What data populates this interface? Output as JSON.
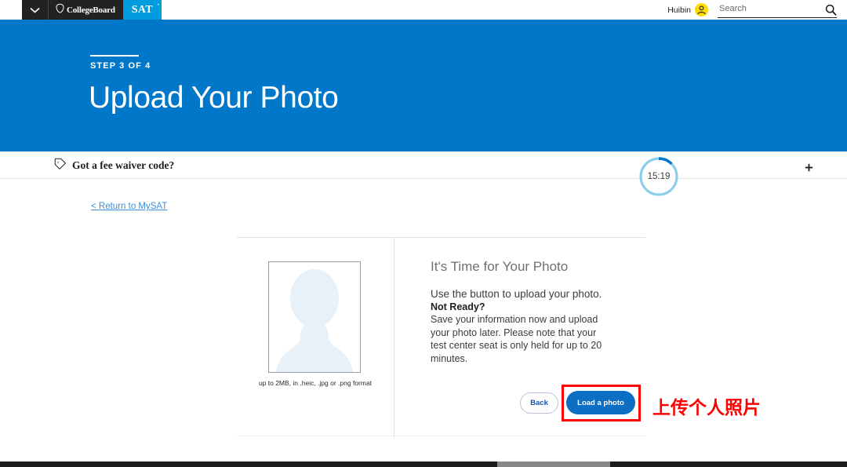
{
  "topnav": {
    "caret_icon": "chevron-down-icon",
    "brand": "CollegeBoard",
    "product": "SAT",
    "trademark": "™",
    "user_name": "Huibin",
    "avatar_icon": "user-avatar-icon",
    "search": {
      "placeholder": "Search",
      "value": "",
      "icon": "search-icon"
    }
  },
  "hero": {
    "step": "STEP 3 OF 4",
    "title": "Upload Your Photo",
    "background_color": "#0077C8"
  },
  "fee_bar": {
    "icon": "price-tag-icon",
    "label": "Got a fee waiver code?",
    "plus_icon": "plus-icon"
  },
  "timer": {
    "value": "15:19",
    "ring_color": "#8ECDEC",
    "progress_color": "#0077C8",
    "progress_percent": 18
  },
  "return_link": {
    "label": "< Return to MySAT",
    "color": "#3b8ede"
  },
  "card": {
    "photo": {
      "placeholder_icon": "person-silhouette-icon",
      "caption": "up to 2MB, in .heic, .jpg or .png format"
    },
    "info": {
      "title": "It's Time for Your Photo",
      "lead": "Use the button to upload your photo.",
      "not_ready_heading": "Not Ready?",
      "body": "Save your information now and upload your photo later. Please note that your test center seat is only held for up to 20 minutes."
    },
    "buttons": {
      "back": "Back",
      "load": "Load a photo"
    }
  },
  "annotation": {
    "text": "上传个人照片",
    "color": "#FF0000",
    "highlight_target": "Load a photo"
  }
}
